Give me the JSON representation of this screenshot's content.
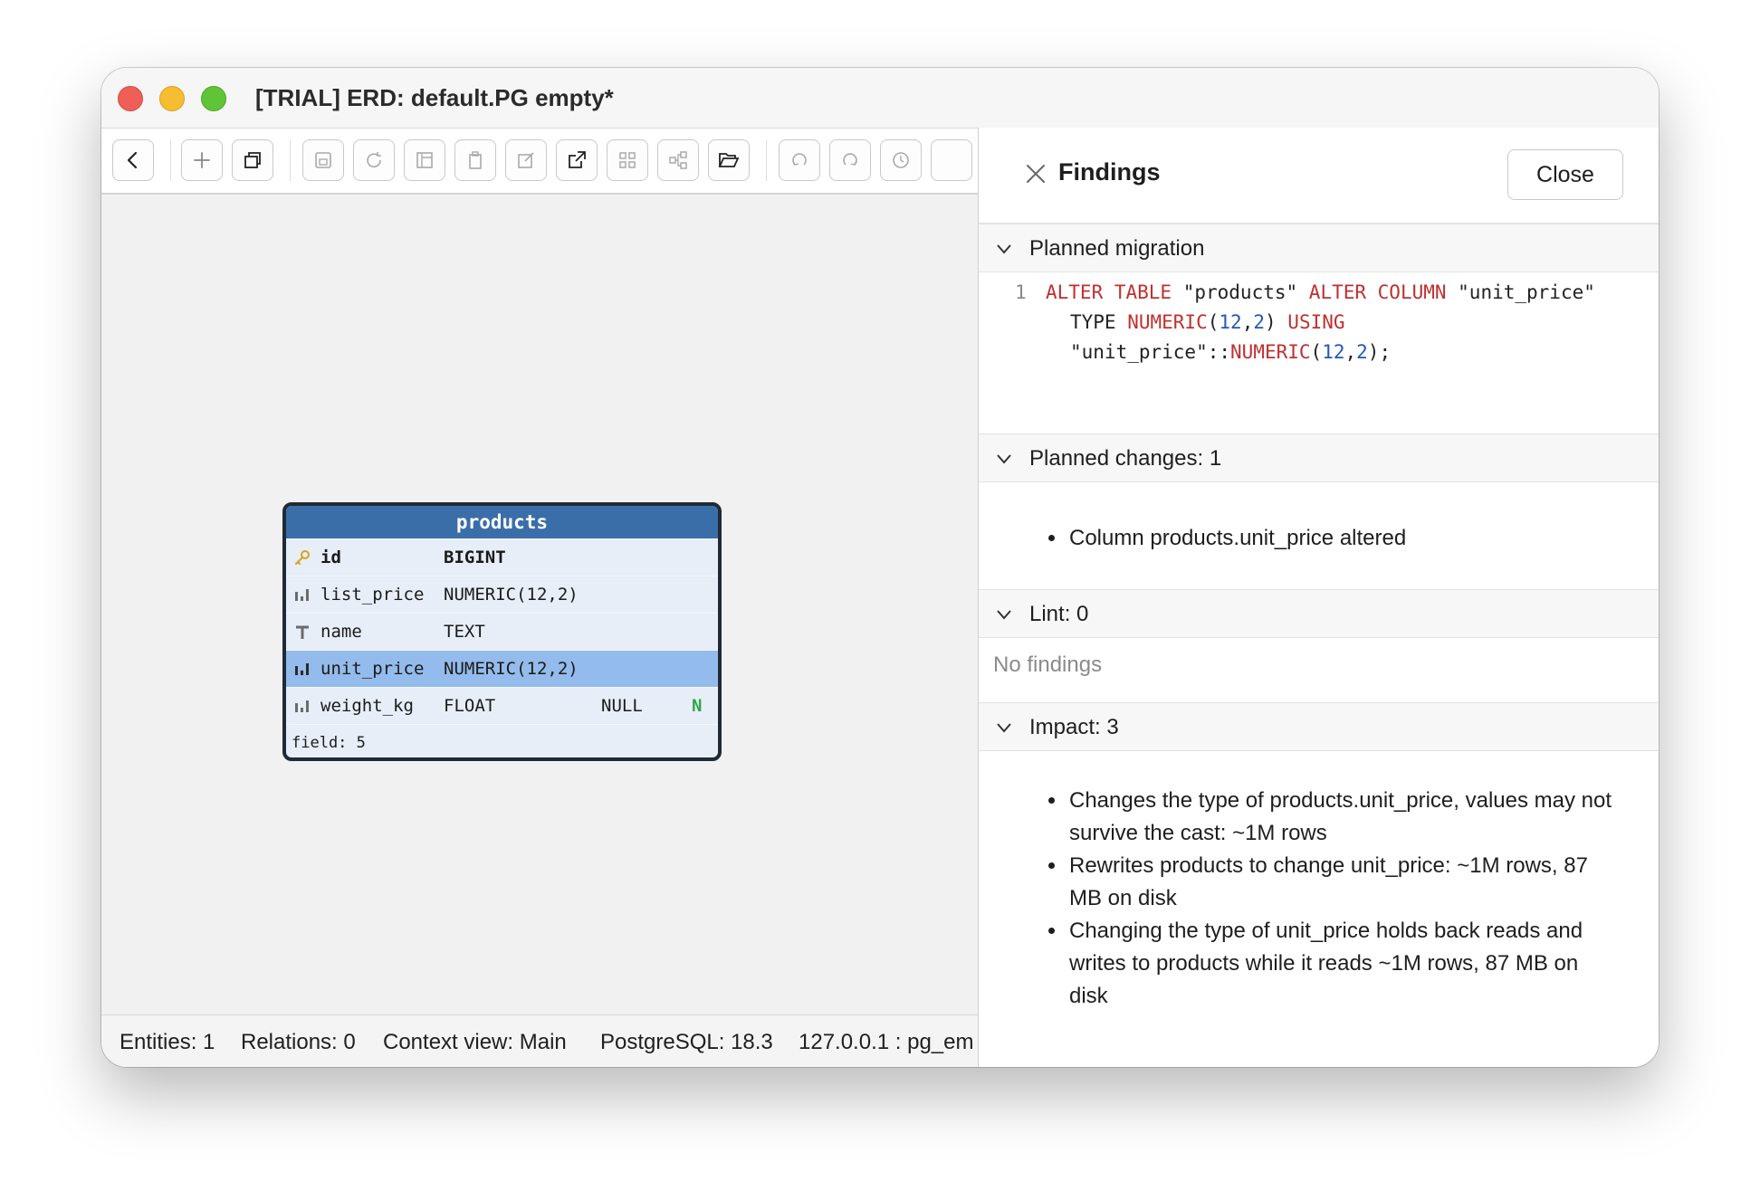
{
  "window": {
    "title": "[TRIAL] ERD: default.PG empty*"
  },
  "toolbar": {
    "icons": [
      "back-icon",
      "add-icon",
      "copy-window-icon",
      "save-icon",
      "refresh-icon",
      "layout-icon",
      "clipboard-icon",
      "edit-icon",
      "external-link-icon",
      "grid-icon",
      "diagram-icon",
      "folder-open-icon",
      "undo-icon",
      "redo-icon",
      "history-icon"
    ]
  },
  "entity": {
    "name": "products",
    "fields": [
      {
        "icon": "key-icon",
        "name": "id",
        "type": "BIGINT",
        "null": "",
        "flag": ""
      },
      {
        "icon": "numeric-icon",
        "name": "list_price",
        "type": "NUMERIC(12,2)",
        "null": "",
        "flag": ""
      },
      {
        "icon": "text-type-icon",
        "name": "name",
        "type": "TEXT",
        "null": "",
        "flag": ""
      },
      {
        "icon": "numeric-icon",
        "name": "unit_price",
        "type": "NUMERIC(12,2)",
        "null": "",
        "flag": ""
      },
      {
        "icon": "numeric-icon",
        "name": "weight_kg",
        "type": "FLOAT",
        "null": "NULL",
        "flag": "N"
      }
    ],
    "footer": "field: 5"
  },
  "status": {
    "entities": "Entities: 1",
    "relations": "Relations: 0",
    "context": "Context view: Main",
    "db": "PostgreSQL: 18.3",
    "conn": "127.0.0.1 : pg_em"
  },
  "findings": {
    "title": "Findings",
    "close_label": "Close",
    "migration": {
      "header": "Planned migration",
      "line_no": "1",
      "code_lines": [
        [
          {
            "t": "ALTER TABLE",
            "k": "kw"
          },
          {
            "t": " \"products\" ",
            "k": ""
          },
          {
            "t": "ALTER COLUMN",
            "k": "kw"
          },
          {
            "t": " \"unit_price\"",
            "k": ""
          }
        ],
        [
          {
            "t": "TYPE ",
            "k": ""
          },
          {
            "t": "NUMERIC",
            "k": "kw"
          },
          {
            "t": "(",
            "k": ""
          },
          {
            "t": "12",
            "k": "num"
          },
          {
            "t": ",",
            "k": ""
          },
          {
            "t": "2",
            "k": "num"
          },
          {
            "t": ") ",
            "k": ""
          },
          {
            "t": "USING",
            "k": "kw"
          }
        ],
        [
          {
            "t": "\"unit_price\"::",
            "k": ""
          },
          {
            "t": "NUMERIC",
            "k": "kw"
          },
          {
            "t": "(",
            "k": ""
          },
          {
            "t": "12",
            "k": "num"
          },
          {
            "t": ",",
            "k": ""
          },
          {
            "t": "2",
            "k": "num"
          },
          {
            "t": ");",
            "k": ""
          }
        ]
      ]
    },
    "changes": {
      "header": "Planned changes: 1",
      "items": [
        "Column products.unit_price altered"
      ]
    },
    "lint": {
      "header": "Lint: 0",
      "empty": "No findings"
    },
    "impact": {
      "header": "Impact: 3",
      "items": [
        "Changes the type of products.unit_price, values may not survive the cast: ~1M rows",
        "Rewrites products to change unit_price: ~1M rows, 87 MB on disk",
        "Changing the type of unit_price holds back reads and writes to products while it reads ~1M rows, 87 MB on disk"
      ]
    }
  },
  "colors": {
    "entity_header": "#3a6ea8",
    "selected_row": "#93bbeb",
    "sql_keyword": "#c0302f",
    "sql_number": "#2458b5",
    "null_flag": "#2fa84c"
  }
}
